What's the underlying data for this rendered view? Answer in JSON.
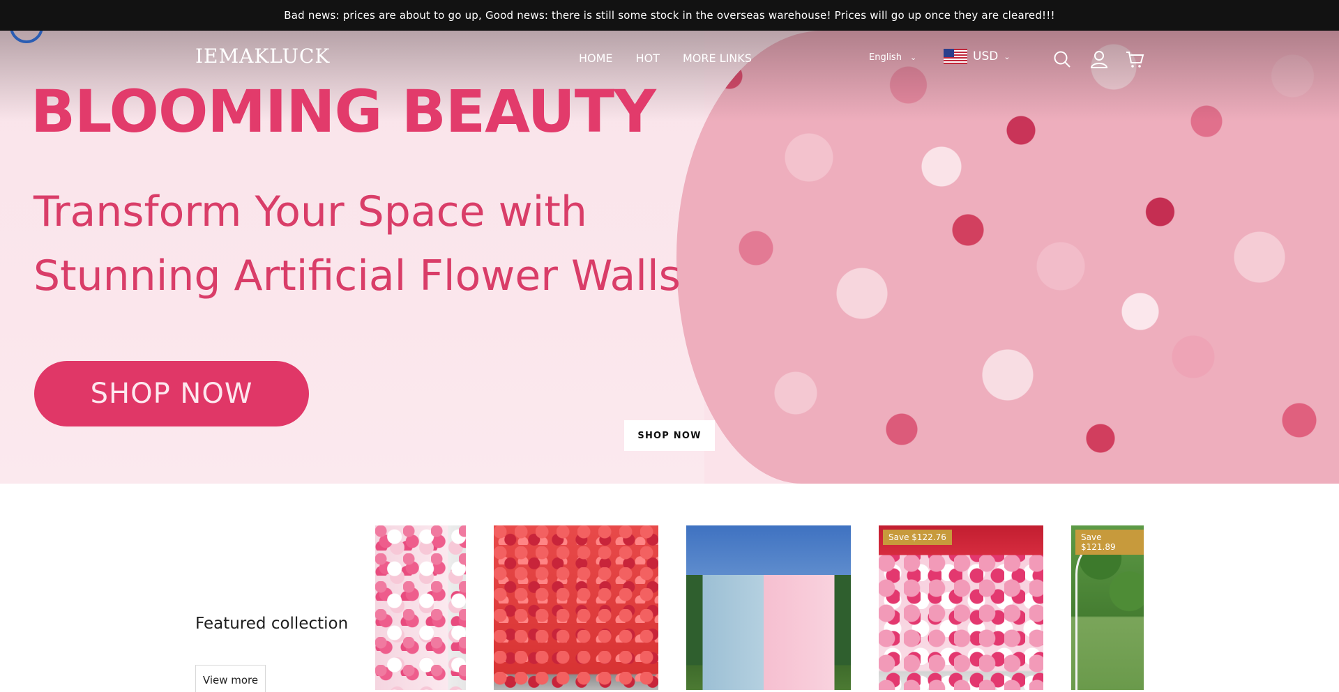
{
  "announcement": {
    "text": "Bad news: prices are about to go up, Good news: there is still some stock in the overseas warehouse! Prices will go up once they are cleared!!!"
  },
  "header": {
    "logo": "IEMAKLUCK",
    "nav": [
      "HOME",
      "HOT",
      "MORE LINKS"
    ],
    "language": "English",
    "currency": "USD",
    "icons": [
      "search-icon",
      "account-icon",
      "cart-icon"
    ]
  },
  "hero": {
    "headline": "BLOOMING BEAUTY",
    "subheadline_line1": "Transform Your Space with",
    "subheadline_line2": "Stunning Artificial Flower Walls",
    "image_button": "SHOP NOW",
    "cta_button": "SHOP NOW"
  },
  "featured": {
    "title": "Featured collection",
    "view_more": "View more",
    "products": [
      {
        "save_badge": ""
      },
      {
        "save_badge": ""
      },
      {
        "save_badge": ""
      },
      {
        "save_badge": "Save $122.76"
      },
      {
        "save_badge": "Save $121.89"
      }
    ]
  },
  "colors": {
    "announcement_bg": "#121212",
    "brand_pink": "#e23b6b",
    "save_badge": "#c79a3c"
  }
}
